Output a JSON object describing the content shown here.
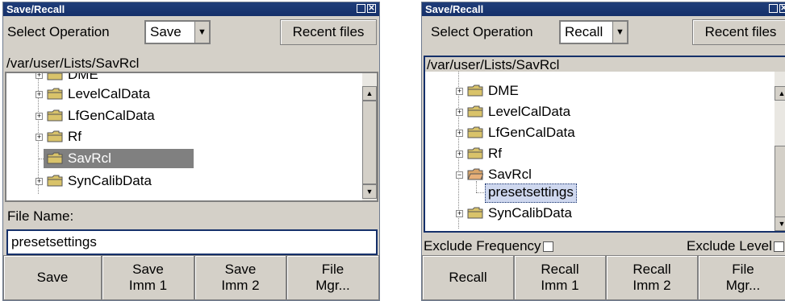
{
  "left": {
    "title": "Save/Recall",
    "select_label": "Select Operation",
    "operation": "Save",
    "recent_files": "Recent files",
    "path": "/var/user/Lists/SavRcl",
    "tree": [
      "DME",
      "LevelCalData",
      "LfGenCalData",
      "Rf",
      "SavRcl",
      "SynCalibData"
    ],
    "file_name_label": "File Name:",
    "file_name_value": "presetsettings",
    "buttons": [
      {
        "l1": "Save",
        "l2": ""
      },
      {
        "l1": "Save",
        "l2": "Imm 1"
      },
      {
        "l1": "Save",
        "l2": "Imm 2"
      },
      {
        "l1": "File",
        "l2": "Mgr..."
      }
    ]
  },
  "right": {
    "title": "Save/Recall",
    "select_label": "Select Operation",
    "operation": "Recall",
    "recent_files": "Recent files",
    "path": "/var/user/Lists/SavRcl",
    "tree": [
      "DME",
      "LevelCalData",
      "LfGenCalData",
      "Rf",
      "SavRcl",
      "presetsettings",
      "SynCalibData"
    ],
    "exclude_frequency": "Exclude Frequency",
    "exclude_level": "Exclude Level",
    "buttons": [
      {
        "l1": "Recall",
        "l2": ""
      },
      {
        "l1": "Recall",
        "l2": "Imm 1"
      },
      {
        "l1": "Recall",
        "l2": "Imm 2"
      },
      {
        "l1": "File",
        "l2": "Mgr..."
      }
    ]
  },
  "icons": [
    "maximize-icon",
    "close-icon",
    "chevron-down-icon",
    "folder-icon",
    "scroll-up-icon",
    "scroll-down-icon"
  ],
  "colors": {
    "titlebar": "#15306a",
    "dialog": "#d4d0c8",
    "selection": "#808080",
    "focus": "#15306a",
    "folder": "#d9c36a"
  }
}
